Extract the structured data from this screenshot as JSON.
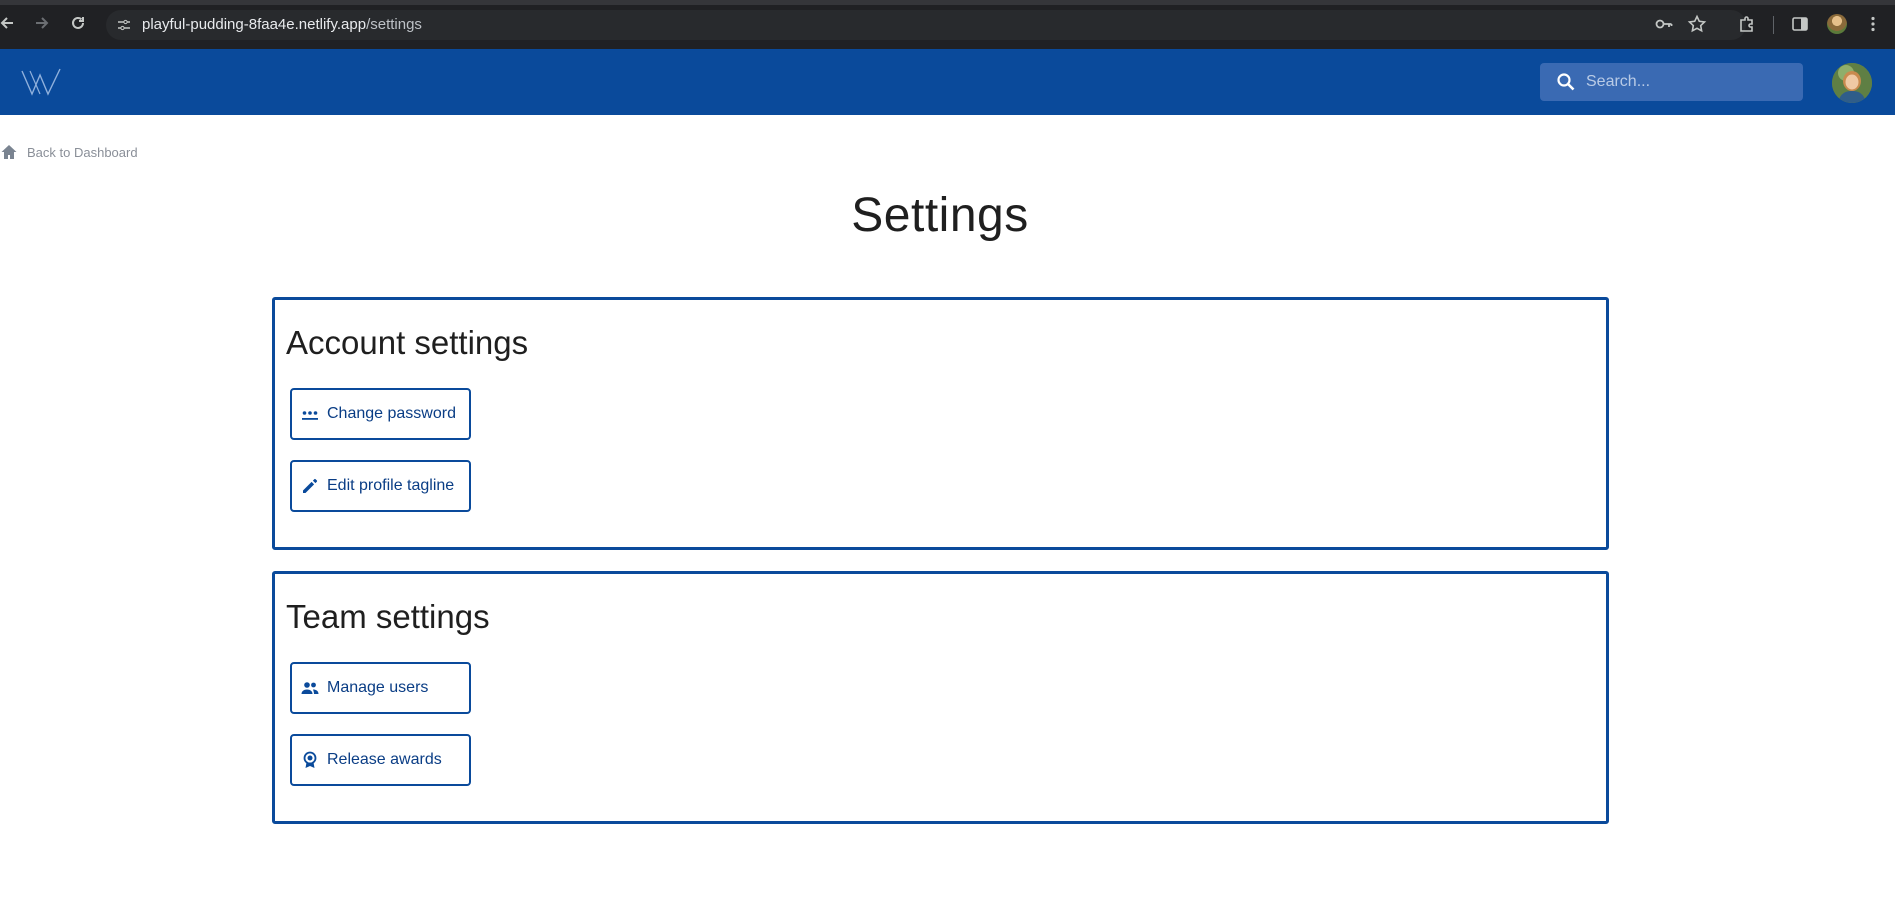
{
  "browser": {
    "url_host": "playful-pudding-8faa4e.netlify.app",
    "url_path": "/settings"
  },
  "header": {
    "search_placeholder": "Search..."
  },
  "breadcrumb": {
    "label": "Back to Dashboard"
  },
  "page": {
    "title": "Settings"
  },
  "sections": [
    {
      "title": "Account settings",
      "buttons": [
        {
          "label": "Change password",
          "icon": "password-icon"
        },
        {
          "label": "Edit profile tagline",
          "icon": "pencil-icon"
        }
      ]
    },
    {
      "title": "Team settings",
      "buttons": [
        {
          "label": "Manage users",
          "icon": "users-icon"
        },
        {
          "label": "Release awards",
          "icon": "award-icon"
        }
      ]
    }
  ],
  "colors": {
    "brand": "#0a4a9b",
    "search_bg": "#3a6ab3",
    "chrome_bg": "#202124"
  }
}
